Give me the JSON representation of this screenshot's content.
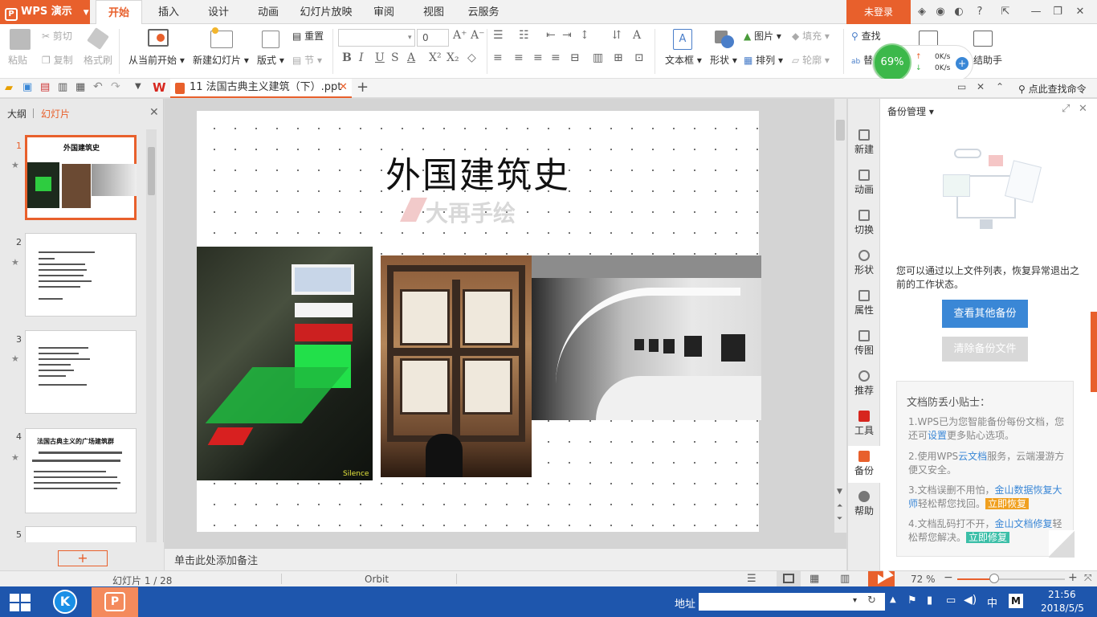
{
  "app": {
    "name": "WPS 演示",
    "login": "未登录"
  },
  "menu_tabs": [
    "开始",
    "插入",
    "设计",
    "动画",
    "幻灯片放映",
    "审阅",
    "视图",
    "云服务"
  ],
  "ribbon": {
    "paste": "粘贴",
    "cut": "剪切",
    "copy": "复制",
    "format_painter": "格式刷",
    "from_current": "从当前开始",
    "new_slide": "新建幻灯片",
    "layout": "版式",
    "reset": "重置",
    "section": "节",
    "font_size": "0",
    "textbox": "文本框",
    "shape": "形状",
    "picture": "图片",
    "fill": "填充",
    "arrange": "排列",
    "outline": "轮廓",
    "find": "查找",
    "replace": "替",
    "assistant": "结助手"
  },
  "net_widget": {
    "percent": "69%",
    "up": "0K/s",
    "down": "0K/s"
  },
  "doc_tab": {
    "title": "11 法国古典主义建筑（下）.ppt"
  },
  "search_cmd": "点此查找命令",
  "left_panel": {
    "tab_outline": "大纲",
    "tab_slides": "幻灯片"
  },
  "thumbs": [
    {
      "num": "1",
      "title": "外国建筑史"
    },
    {
      "num": "2"
    },
    {
      "num": "3"
    },
    {
      "num": "4",
      "title": "法国古典主义的广场建筑群"
    },
    {
      "num": "5"
    }
  ],
  "slide": {
    "title": "外国建筑史",
    "watermark": "大再手绘",
    "photo_credit": "Silence"
  },
  "notes_placeholder": "单击此处添加备注",
  "sidebar": [
    "新建",
    "动画",
    "切换",
    "形状",
    "属性",
    "传图",
    "推荐",
    "工具",
    "备份",
    "帮助"
  ],
  "backup": {
    "title": "备份管理",
    "desc": "您可以通过以上文件列表，恢复异常退出之前的工作状态。",
    "view_btn": "查看其他备份",
    "clear_btn": "清除备份文件",
    "tips_title": "文档防丢小贴士：",
    "tip1_a": "1.WPS已为您智能备份每份文档，您还可",
    "tip1_link": "设置",
    "tip1_b": "更多贴心选项。",
    "tip2_a": "2.使用WPS",
    "tip2_link": "云文档",
    "tip2_b": "服务，云端漫游方便又安全。",
    "tip3_a": "3.文档误删不用怕，",
    "tip3_link": "金山数据恢复大师",
    "tip3_b": "轻松帮您找回。",
    "tip3_tag": "立即恢复",
    "tip4_a": "4.文档乱码打不开，",
    "tip4_link": "金山文档修复",
    "tip4_b": "轻松帮您解决。",
    "tip4_tag": "立即修复"
  },
  "status": {
    "slide_pos": "幻灯片 1 / 28",
    "theme": "Orbit",
    "zoom": "72 %"
  },
  "taskbar": {
    "address_label": "地址",
    "time": "21:56",
    "date": "2018/5/5",
    "ime": "中"
  }
}
